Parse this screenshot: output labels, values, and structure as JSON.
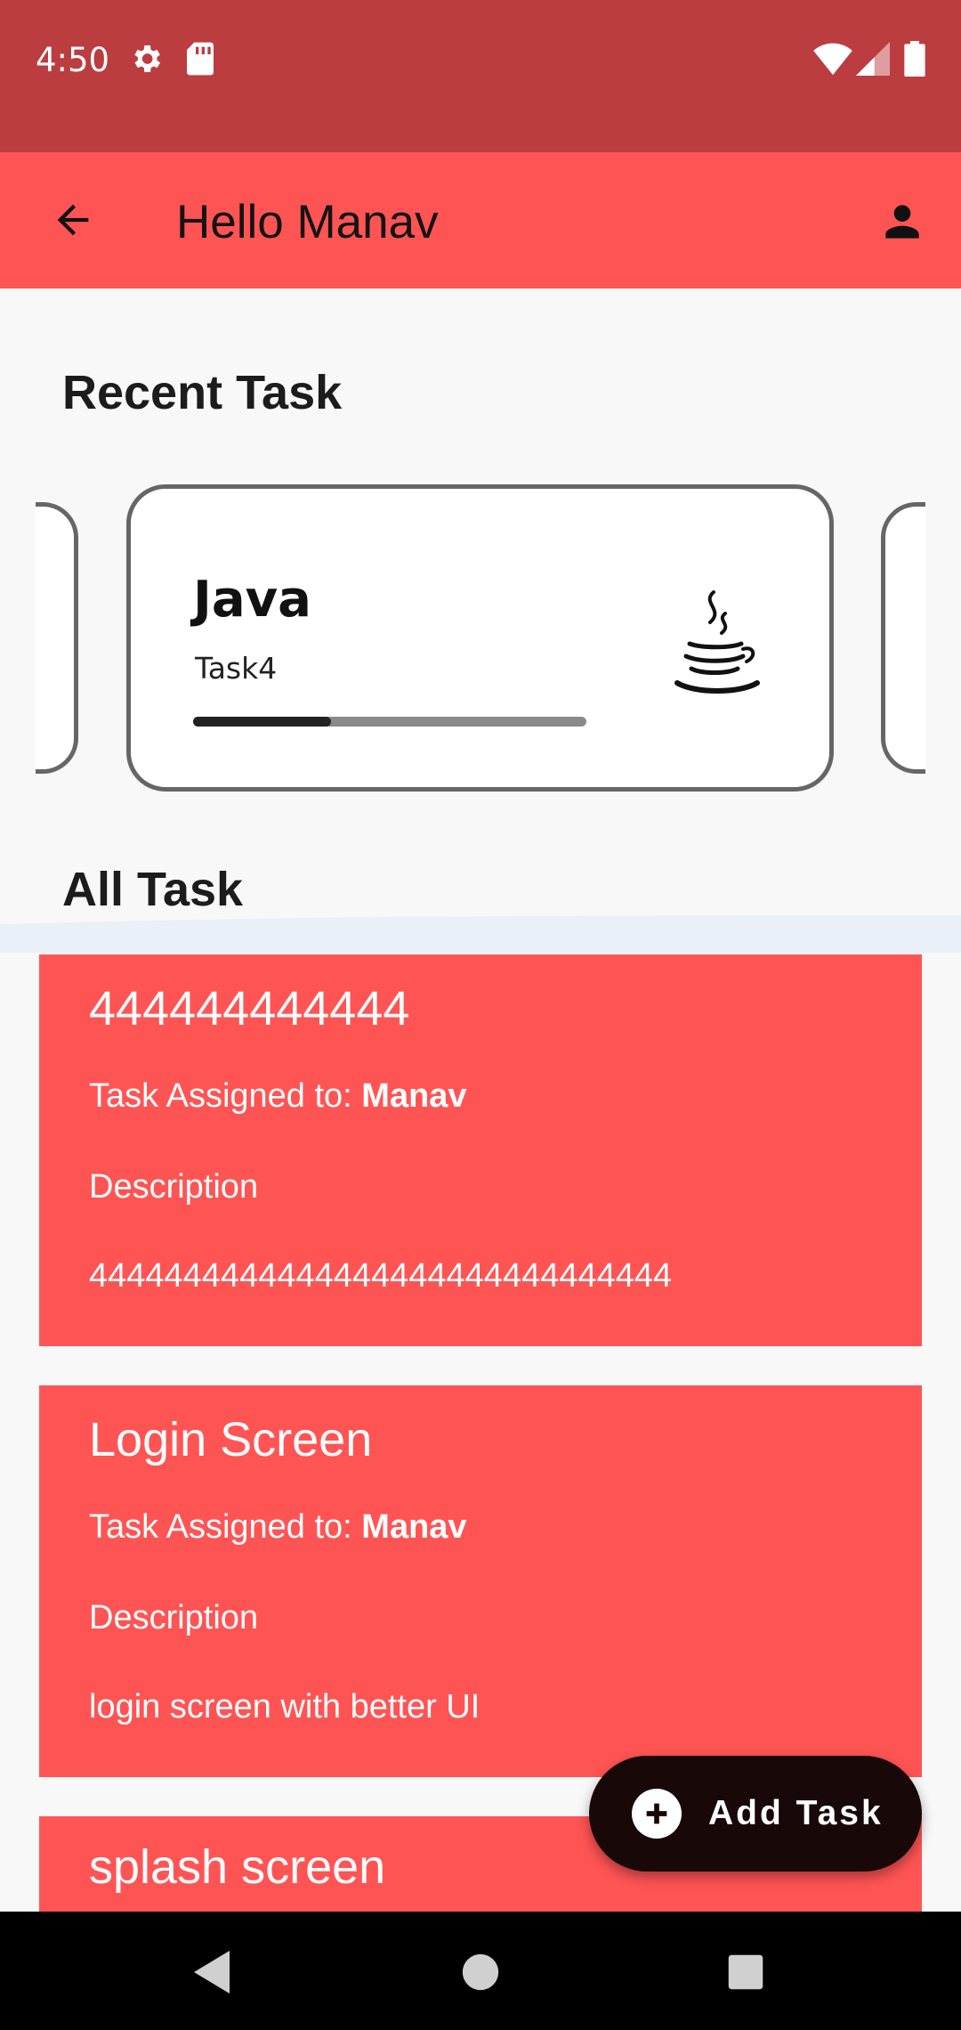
{
  "status_bar": {
    "time": "4:50",
    "icons": [
      "settings-icon",
      "sd-card-icon",
      "wifi-icon",
      "signal-icon",
      "battery-icon"
    ]
  },
  "app_bar": {
    "title": "Hello Manav",
    "back_icon": "arrow-back-icon",
    "profile_icon": "person-icon"
  },
  "recent": {
    "heading": "Recent Task",
    "card": {
      "title": "Java",
      "subtitle": "Task4",
      "progress": 0.35,
      "logo_icon": "java-logo-icon"
    }
  },
  "all": {
    "heading": "All Task",
    "assigned_label": "Task Assigned to:",
    "description_label": "Description",
    "tasks": [
      {
        "title": "444444444444",
        "assignee": "Manav",
        "description": "4444444444444444444444444444444"
      },
      {
        "title": "Login Screen",
        "assignee": "Manav",
        "description": "login screen with better UI"
      },
      {
        "title": "splash screen"
      }
    ]
  },
  "fab": {
    "label": "Add Task",
    "icon": "add-circle-icon"
  },
  "nav": {
    "icons": [
      "back-triangle-icon",
      "home-circle-icon",
      "recents-square-icon"
    ]
  },
  "colors": {
    "status_bar": "#bc3d3f",
    "accent": "#ff5454",
    "fab": "#190808"
  }
}
